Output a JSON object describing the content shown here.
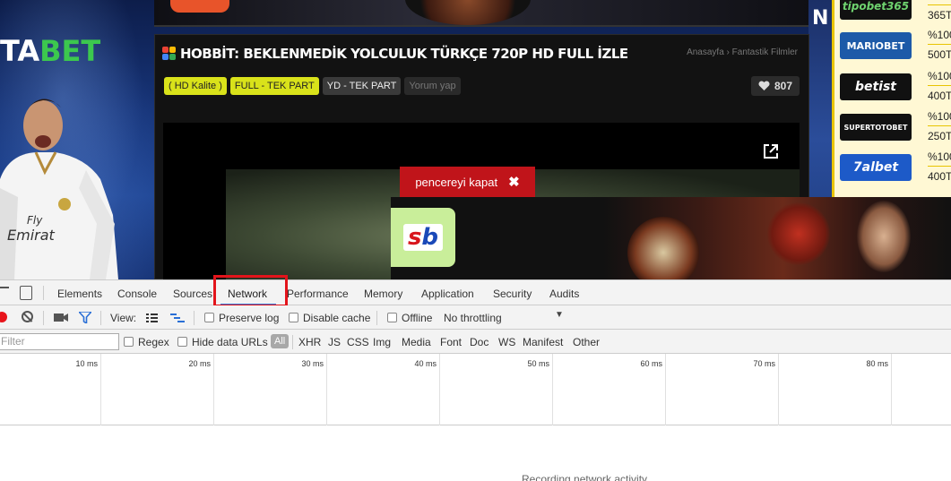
{
  "site": {
    "logo_white": "TA",
    "logo_green": "BET",
    "right_letter": "N",
    "movie_title": "HOBBİT: BEKLENMEDİK YOLCULUK TÜRKÇE 720P HD FULL İZLE",
    "breadcrumb": "Anasayfa › Fantastik Filmler",
    "tags": [
      "( HD Kalite )",
      "FULL - TEK PART",
      "YD - TEK PART",
      "Yorum yap"
    ],
    "likes": "807",
    "popup_close_label": "pencereyi kapat"
  },
  "sidebar": {
    "items": [
      {
        "brand": "tipobet365",
        "percent": "",
        "amount": "365T"
      },
      {
        "brand": "MARIOBET",
        "percent": "%100",
        "amount": "500T"
      },
      {
        "brand": "betist",
        "percent": "%100",
        "amount": "400T"
      },
      {
        "brand": "SUPERTOTOBET",
        "percent": "%100",
        "amount": "250T"
      },
      {
        "brand": "7albet",
        "percent": "%100",
        "amount": "400T"
      }
    ]
  },
  "devtools": {
    "tabs": [
      "Elements",
      "Console",
      "Sources",
      "Network",
      "Performance",
      "Memory",
      "Application",
      "Security",
      "Audits"
    ],
    "active_tab": "Network",
    "view_label": "View:",
    "preserve_log": "Preserve log",
    "disable_cache": "Disable cache",
    "offline": "Offline",
    "throttling": "No throttling",
    "filter_placeholder": "Filter",
    "regex": "Regex",
    "hide_data_urls": "Hide data URLs",
    "type_filters": [
      "All",
      "XHR",
      "JS",
      "CSS",
      "Img",
      "Media",
      "Font",
      "Doc",
      "WS",
      "Manifest",
      "Other"
    ],
    "timeline_ticks": [
      "10 ms",
      "20 ms",
      "30 ms",
      "40 ms",
      "50 ms",
      "60 ms",
      "70 ms",
      "80 ms"
    ],
    "recording_message": "Recording network activity..."
  }
}
